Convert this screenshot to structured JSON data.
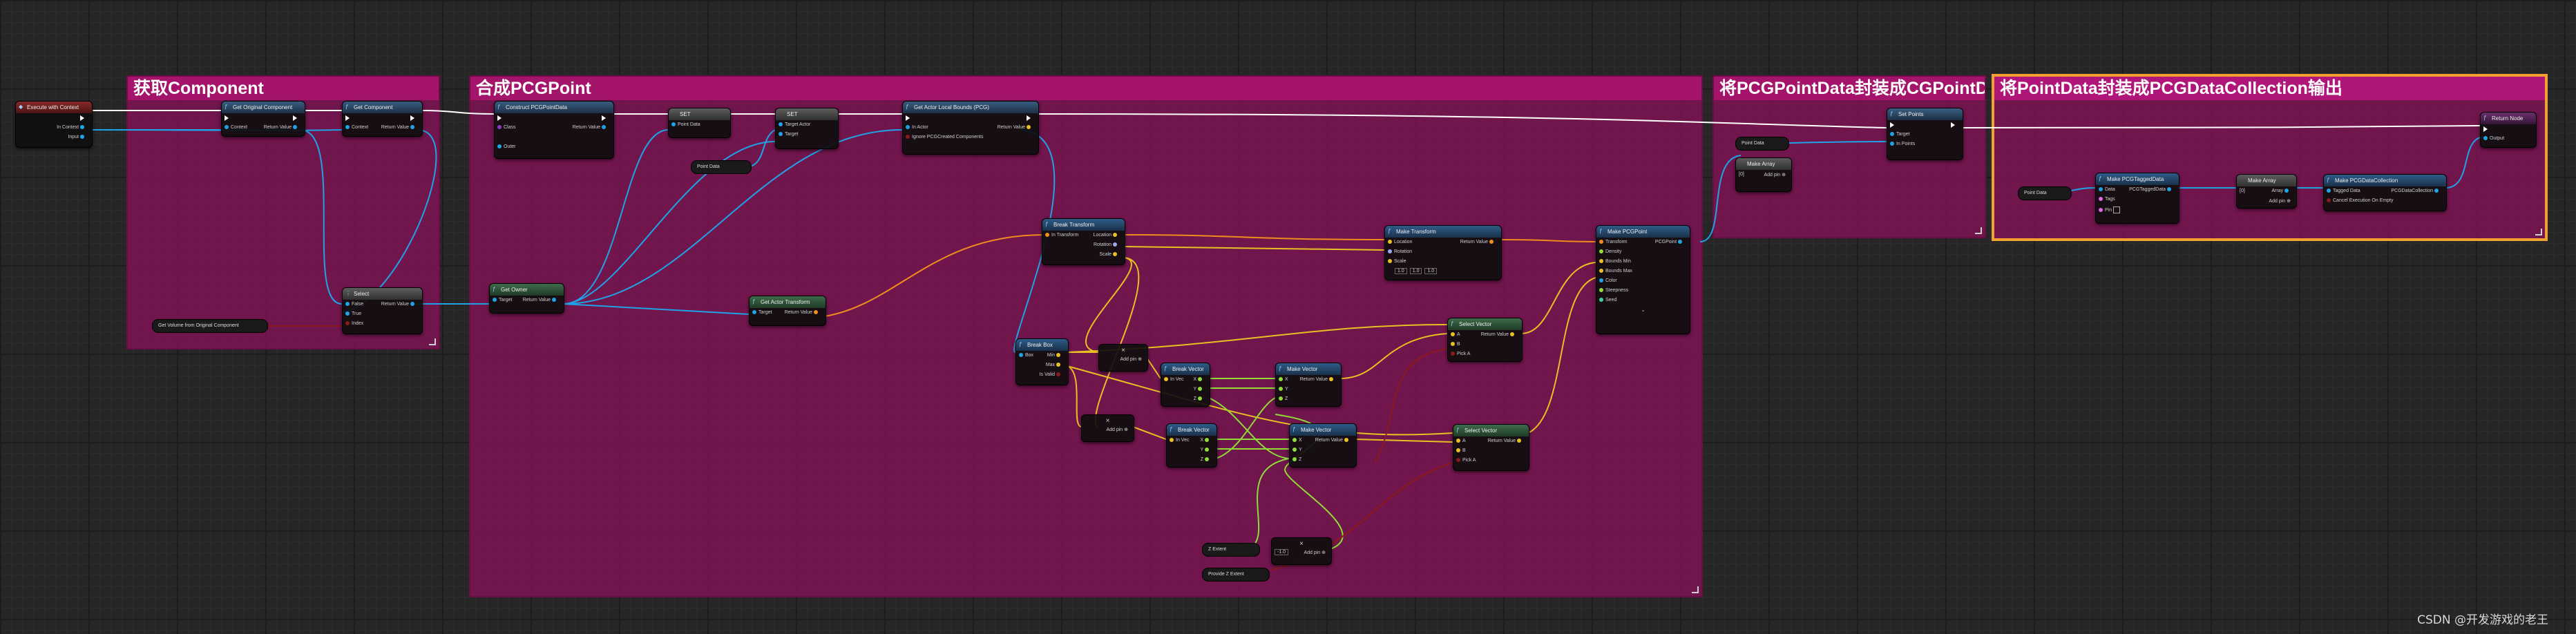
{
  "comments": {
    "get_component": "获取Component",
    "combine_point": "合成PCGPoint",
    "wrap_point_data": "将PCGPointData封装成CGPointData",
    "wrap_collection": "将PointData封装成PCGDataCollection输出"
  },
  "nodes": {
    "execute_with_context": {
      "title": "Execute with Context",
      "in_context": "In Context",
      "input": "Input"
    },
    "get_original_component": {
      "title": "Get Original Component",
      "context": "Context",
      "return_value": "Return Value"
    },
    "get_component": {
      "title": "Get Component",
      "context": "Context",
      "return_value": "Return Value"
    },
    "select": {
      "title": "Select",
      "false": "False",
      "true": "True",
      "index": "Index",
      "return_value": "Return Value"
    },
    "use_original": {
      "title": "Get Volume from Original Component"
    },
    "construct_point_data": {
      "title": "Construct PCGPointData",
      "class": "Class",
      "outer": "Outer",
      "return_value": "Return Value"
    },
    "set1": {
      "title": "SET",
      "point_data": "Point Data"
    },
    "set2": {
      "title": "SET",
      "target_actor": "Target Actor",
      "target": "Target"
    },
    "point_data_var": {
      "title": "Point Data"
    },
    "set_actor_bounds": {
      "title": "Get Actor Local Bounds (PCG)",
      "in_actor": "In Actor",
      "ignore": "Ignore PCGCreated Components",
      "return_value": "Return Value"
    },
    "get_owner": {
      "title": "Get Owner",
      "target": "Target",
      "return_value": "Return Value"
    },
    "get_actor_transform": {
      "title": "Get Actor Transform",
      "target": "Target",
      "return_value": "Return Value"
    },
    "break_transform": {
      "title": "Break Transform",
      "in_transform": "In Transform",
      "location": "Location",
      "rotation": "Rotation",
      "scale": "Scale"
    },
    "make_transform": {
      "title": "Make Transform",
      "location": "Location",
      "rotation": "Rotation",
      "scale": "Scale",
      "return_value": "Return Value",
      "scale_x": "1.0",
      "scale_y": "1.0",
      "scale_z": "1.0"
    },
    "break_box": {
      "title": "Break Box",
      "box": "Box",
      "min": "Min",
      "max": "Max",
      "is_valid": "Is Valid"
    },
    "multiply1": {
      "title": "×",
      "add_pin": "Add pin"
    },
    "break_vector1": {
      "title": "Break Vector",
      "in_vec": "In Vec",
      "x": "X",
      "y": "Y",
      "z": "Z"
    },
    "make_vector1": {
      "title": "Make Vector",
      "x": "X",
      "y": "Y",
      "z": "Z",
      "return_value": "Return Value"
    },
    "select_vector1": {
      "title": "Select Vector",
      "a": "A",
      "b": "B",
      "pick_a": "Pick A",
      "return_value": "Return Value"
    },
    "multiply2": {
      "title": "×",
      "add_pin": "Add pin"
    },
    "break_vector2": {
      "title": "Break Vector",
      "in_vec": "In Vec",
      "x": "X",
      "y": "Y",
      "z": "Z"
    },
    "make_vector2": {
      "title": "Make Vector",
      "x": "X",
      "y": "Y",
      "z": "Z",
      "return_value": "Return Value"
    },
    "select_vector2": {
      "title": "Select Vector",
      "a": "A",
      "b": "B",
      "pick_a": "Pick A",
      "return_value": "Return Value"
    },
    "make_pcg_point": {
      "title": "Make PCGPoint",
      "transform": "Transform",
      "density": "Density",
      "bounds_min": "Bounds Min",
      "bounds_max": "Bounds Max",
      "color": "Color",
      "steepness": "Steepness",
      "seed": "Seed",
      "pcg_point": "PCGPoint"
    },
    "z_extent": {
      "title": "Z Extent"
    },
    "multiply3": {
      "title": "×",
      "add_pin": "Add pin",
      "value": "-1.0"
    },
    "provide_z": {
      "title": "Provide Z Extent"
    },
    "set_points": {
      "title": "Set Points",
      "target": "Target",
      "in_points": "In Points"
    },
    "point_data_var2": {
      "title": "Point Data"
    },
    "make_array": {
      "title": "Make Array",
      "add_pin": "Add pin",
      "value": "[0]"
    },
    "point_data_var3": {
      "title": "Point Data"
    },
    "make_tagged_data": {
      "title": "Make PCGTaggedData",
      "data": "Data",
      "tags": "Tags",
      "pin": "Pin",
      "return_value": "PCGTaggedData"
    },
    "make_array2": {
      "title": "Make Array",
      "add_pin": "Add pin",
      "value": "[0]",
      "array": "Array"
    },
    "make_collection": {
      "title": "Make PCGDataCollection",
      "tagged_data": "Tagged Data",
      "cancel": "Cancel Execution On Empty",
      "return_value": "PCGDataCollection"
    },
    "return_node": {
      "title": "Return Node",
      "output": "Output"
    }
  },
  "watermark": "CSDN @开发游戏的老王",
  "colors": {
    "comment": "#a3146a",
    "exec_wire": "#ffffff",
    "object_wire": "#1fa3e6",
    "struct_wire": "#f08c1e",
    "vector_wire": "#e8c024",
    "float_wire": "#8fdb3a",
    "bool_wire": "#8b1a1a",
    "selection": "#f2a031"
  }
}
